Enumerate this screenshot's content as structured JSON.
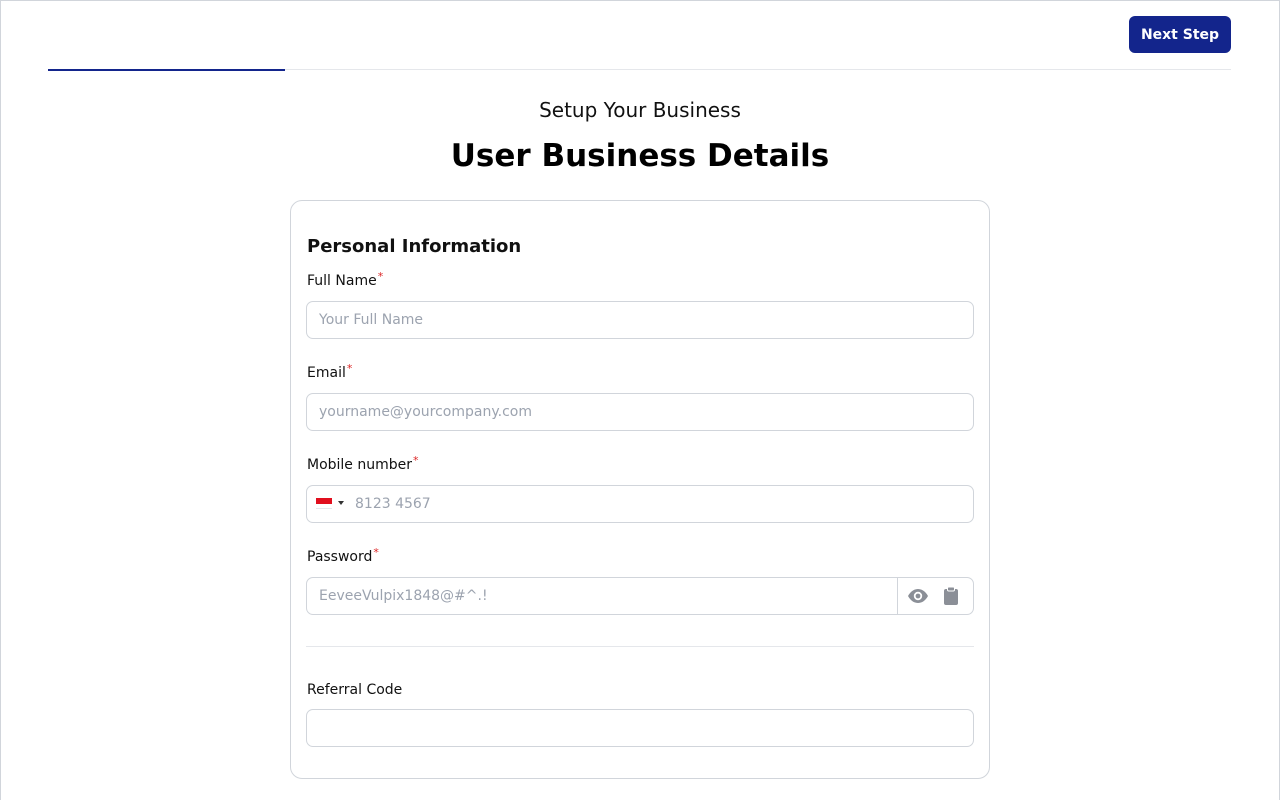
{
  "topbar": {
    "next_step_label": "Next Step"
  },
  "progress": {
    "fraction": 0.2
  },
  "header": {
    "subtitle": "Setup Your Business",
    "title": "User Business Details"
  },
  "form": {
    "section_title": "Personal Information",
    "required_marker": "*",
    "full_name": {
      "label": "Full Name",
      "placeholder": "Your Full Name",
      "value": ""
    },
    "email": {
      "label": "Email",
      "placeholder": "yourname@yourcompany.com",
      "value": ""
    },
    "mobile": {
      "label": "Mobile number",
      "placeholder": "8123 4567",
      "value": "",
      "country_flag_icon": "singapore-flag-icon"
    },
    "password": {
      "label": "Password",
      "placeholder": "EeveeVulpix1848@#^.!",
      "value": "",
      "reveal_icon": "eye-icon",
      "copy_icon": "clipboard-icon"
    },
    "referral": {
      "label": "Referral Code",
      "placeholder": "",
      "value": ""
    }
  },
  "colors": {
    "accent": "#13258c",
    "required": "#dc2626",
    "border": "#d1d5db",
    "placeholder": "#9ca3af"
  }
}
